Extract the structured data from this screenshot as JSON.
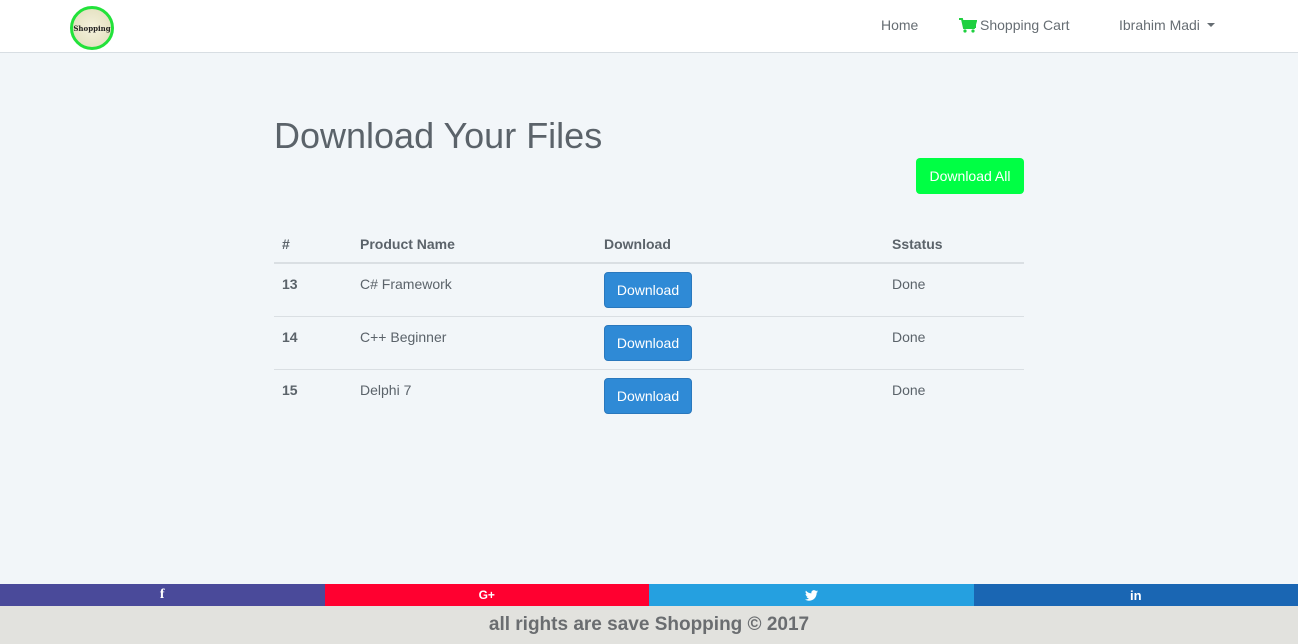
{
  "brand": {
    "logo_text": "Shopping",
    "logo_icon": "shopping-logo"
  },
  "nav": {
    "home": "Home",
    "cart": "Shopping Cart",
    "cart_icon": "cart-icon",
    "user": "Ibrahim Madi"
  },
  "page": {
    "title": "Download Your Files",
    "download_all": "Download All"
  },
  "table": {
    "headers": [
      "#",
      "Product Name",
      "Download",
      "Sstatus"
    ],
    "rows": [
      {
        "id": "13",
        "name": "C# Framework",
        "button": "Download",
        "status": "Done"
      },
      {
        "id": "14",
        "name": "C++ Beginner",
        "button": "Download",
        "status": "Done"
      },
      {
        "id": "15",
        "name": "Delphi 7",
        "button": "Download",
        "status": "Done"
      }
    ]
  },
  "social": [
    {
      "icon": "facebook-icon",
      "glyph": "f",
      "color": "#4a4a9a"
    },
    {
      "icon": "google-plus-icon",
      "glyph": "G+",
      "color": "#ff0030"
    },
    {
      "icon": "twitter-icon",
      "glyph": "🐦",
      "color": "#25a0e0"
    },
    {
      "icon": "linkedin-icon",
      "glyph": "in",
      "color": "#1a66b3"
    }
  ],
  "colors": {
    "accent_green": "#00ff44",
    "download_blue": "#2f8ad6",
    "cart_green": "#1fd040"
  },
  "footer": {
    "text": "all rights are save Shopping © 2017"
  }
}
